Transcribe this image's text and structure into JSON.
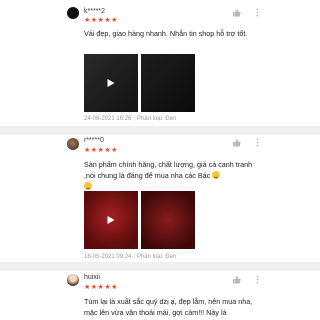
{
  "reviews": [
    {
      "username": "k*****2",
      "stars": "★★★★★",
      "comment": "Vải đẹp, giao hàng nhanh. Nhắn tin shop hỗ trợ tốt.",
      "date": "24-06-2021 16:26",
      "variation": "Phân loại: Đen"
    },
    {
      "username": "r*****0",
      "stars": "★★★★★",
      "comment": "Sản phẩm chính hãng, chất lượng, giá cả canh tranh ,nói chung là đáng để mua nha các Bác",
      "date": "16-05-2021 09:24",
      "variation": "Phân loại: Đen"
    },
    {
      "username": "huixii",
      "stars": "★★★★★",
      "comment": "Tùm lại là xuất sắc quý dzị ạ, đẹp lắm, nên mua nha, mặc lên vừa vặn thoải mái, gợi cảm!!! Này là"
    }
  ],
  "colors": {
    "star": "#ee4d2d",
    "meta": "#9a9a9a",
    "separator": "#f0f0f0"
  },
  "icons": {
    "like": "thumbs-up-icon",
    "more": "more-vertical-icon",
    "play": "play-icon"
  }
}
